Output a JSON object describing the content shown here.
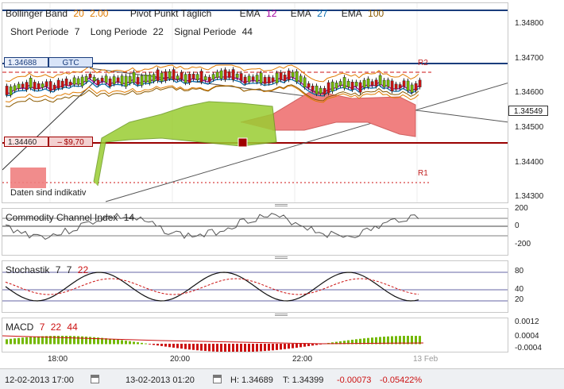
{
  "colors": {
    "bollinger": "#e07b00",
    "pivot": "#1a3d7c",
    "ema12": "#a000a0",
    "ema27": "#0a6db0",
    "ema100": "#8b5a00",
    "green": "#73b800",
    "red": "#cc1111",
    "cloud_green": "#9acd32",
    "cloud_red": "#f08080"
  },
  "main_legend": {
    "bollinger_label": "Bollinger Band",
    "bollinger_p1": "20",
    "bollinger_p2": "2.00",
    "pivot_label": "Pivot Punkt  Täglich",
    "ema_a_label": "EMA",
    "ema_a_val": "12",
    "ema_b_label": "EMA",
    "ema_b_val": "27",
    "ema_c_label": "EMA",
    "ema_c_val": "100",
    "short_label": "Short Periode",
    "short_val": "7",
    "long_label": "Long Periode",
    "long_val": "22",
    "signal_label": "Signal Periode",
    "signal_val": "44"
  },
  "order_badge": {
    "price": "1.34688",
    "type": "GTC"
  },
  "position_badge": {
    "price": "1.34460",
    "pl": "– $9,70"
  },
  "current_price": "1.34549",
  "pivot_labels": {
    "r2": "R2",
    "r1": "R1"
  },
  "disclaimer": "Daten sind indikativ",
  "main_ticks": [
    "1.34800",
    "1.34700",
    "1.34600",
    "1.34500",
    "1.34400",
    "1.34300"
  ],
  "cci": {
    "label": "Commodity Channel Index",
    "period": "14",
    "ticks": [
      "200",
      "0",
      "-200"
    ]
  },
  "stoch": {
    "label": "Stochastik",
    "p1": "7",
    "p2": "7",
    "p3": "22",
    "ticks": [
      "80",
      "40",
      "20"
    ]
  },
  "macd": {
    "label": "MACD",
    "p1": "7",
    "p2": "22",
    "p3": "44",
    "ticks": [
      "0.0012",
      "0.0004",
      "-0.0004"
    ]
  },
  "time_ticks": [
    "18:00",
    "20:00",
    "22:00",
    "13 Feb"
  ],
  "footer": {
    "start": "12-02-2013 17:00",
    "end": "13-02-2013 01:20",
    "high": "H: 1.34689",
    "low": "T: 1.34399",
    "change": "-0.00073",
    "change_pct": "-0.05422%"
  }
}
